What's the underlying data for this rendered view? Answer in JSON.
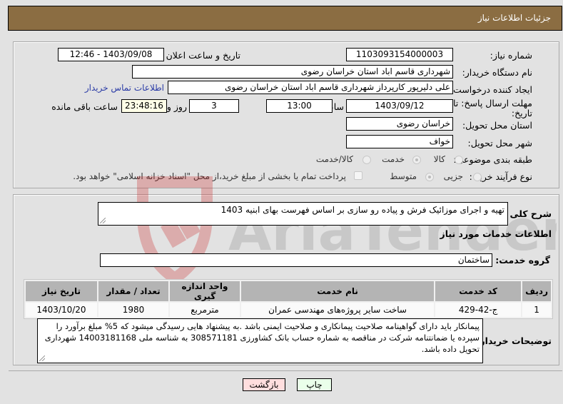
{
  "header": {
    "title": "جزئیات اطلاعات نیاز"
  },
  "form": {
    "need_number": {
      "label": "شماره نیاز:",
      "value": "1103093154000003"
    },
    "announce_datetime": {
      "label": "تاریخ و ساعت اعلان عمومی:",
      "value": "1403/09/08 - 12:46"
    },
    "buyer_org": {
      "label": "نام دستگاه خریدار:",
      "value": "شهرداری قاسم اباد استان خراسان رضوی"
    },
    "requester": {
      "label": "ایجاد کننده درخواست:",
      "value": "علی دلیرپور کارپرداز شهرداری قاسم اباد استان خراسان رضوی"
    },
    "contact_link": "اطلاعات تماس خریدار",
    "deadline": {
      "label_line1": "مهلت ارسال پاسخ: تا",
      "label_line2": "تاریخ:",
      "date": "1403/09/12",
      "time_label": "ساعت",
      "time": "13:00",
      "days": "3",
      "days_label": "روز و",
      "remaining": "23:48:16",
      "remaining_label": "ساعت باقی مانده"
    },
    "delivery_province": {
      "label": "استان محل تحویل:",
      "value": "خراسان رضوی"
    },
    "delivery_city": {
      "label": "شهر محل تحویل:",
      "value": "خواف"
    },
    "category": {
      "label": "طبقه بندی موضوعی:",
      "options": [
        {
          "label": "کالا",
          "checked": false
        },
        {
          "label": "خدمت",
          "checked": true
        },
        {
          "label": "کالا/خدمت",
          "checked": false
        }
      ]
    },
    "purchase_type": {
      "label": "نوع فرآیند خرید :",
      "options": [
        {
          "label": "جزیی",
          "checked": false
        },
        {
          "label": "متوسط",
          "checked": true
        }
      ],
      "treasury_checkbox_label": "پرداخت تمام یا بخشی از مبلغ خرید،از محل \"اسناد خزانه اسلامی\" خواهد بود.",
      "treasury_checked": false
    }
  },
  "description": {
    "label": "شرح کلی نیاز:",
    "value": "تهیه و اجرای موزائیک فرش و پیاده رو سازی بر اساس فهرست بهای ابنیه 1403"
  },
  "services": {
    "section_title": "اطلاعات خدمات مورد نیاز",
    "group_label": "گروه خدمت:",
    "group_value": "ساختمان",
    "columns": [
      "ردیف",
      "کد خدمت",
      "نام خدمت",
      "واحد اندازه گیری",
      "تعداد / مقدار",
      "تاریخ نیاز"
    ],
    "rows": [
      [
        "1",
        "ج-42-429",
        "ساخت سایر پروژه‌های مهندسی عمران",
        "مترمربع",
        "1980",
        "1403/10/20"
      ]
    ]
  },
  "buyer_notes": {
    "label": "توضیحات خریدار:",
    "value": "پیمانکار باید دارای گواهینامه صلاحیت پیمانکاری و صلاحیت ایمنی باشد .به پیشنهاد هایی رسیدگی میشود که 5% مبلغ برآورد را سپرده یا ضمانتنامه شرکت در مناقصه به شماره حساب بانک کشاورزی 308571181 به شناسه ملی 14003181168 شهرداری تحویل داده باشد."
  },
  "buttons": {
    "print": "چاپ",
    "back": "بازگشت"
  },
  "watermark": "AriaTender.neT",
  "colors": {
    "title_bar": "#8b6d42",
    "print_bg": "#eaffea",
    "back_bg": "#ffdede",
    "link": "#2a3ba6"
  }
}
